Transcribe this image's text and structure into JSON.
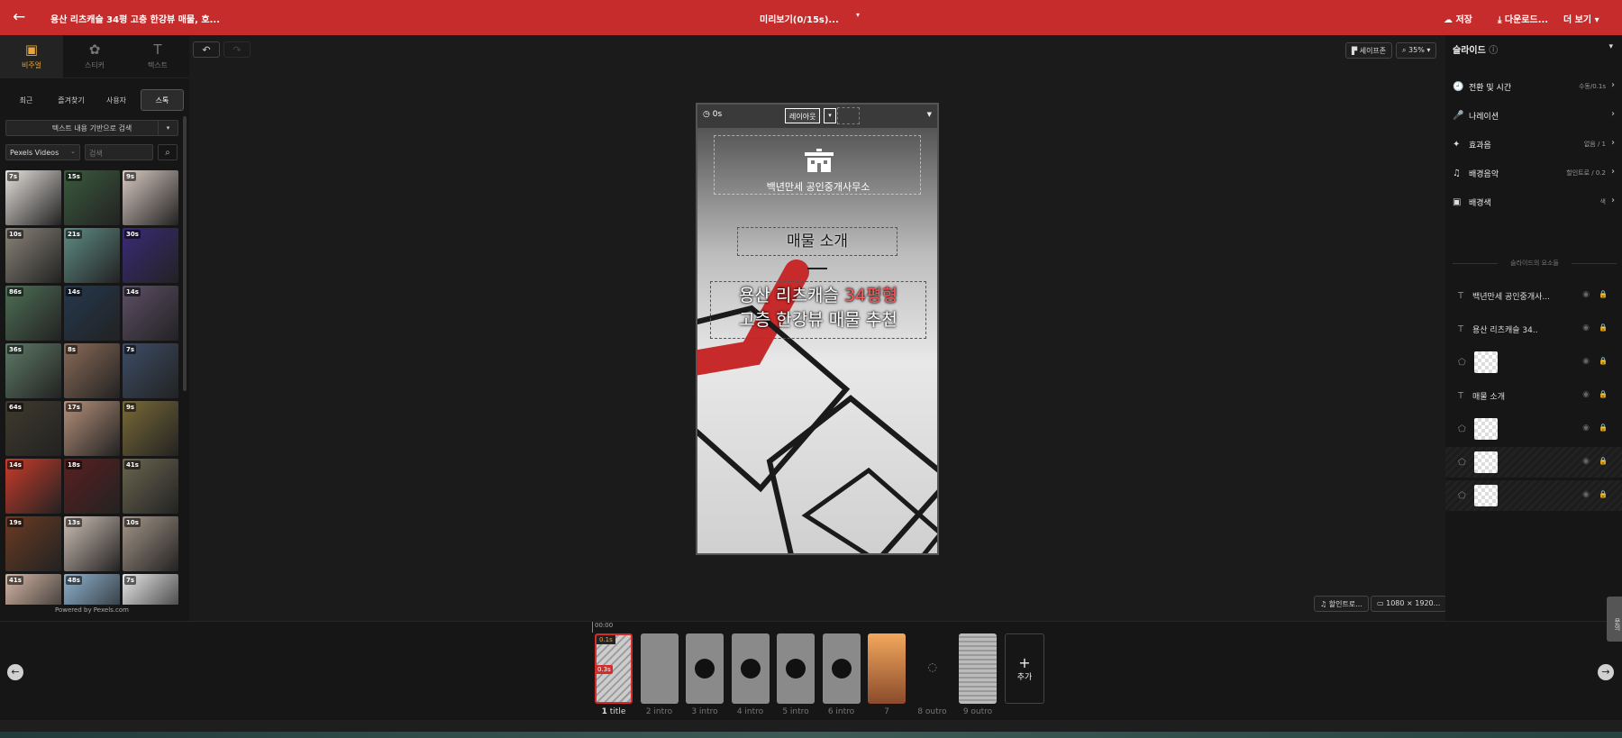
{
  "topbar": {
    "back_label": "←",
    "title": "용산 리츠캐슬 34평 고층 한강뷰 매물, 호...",
    "preview": "미리보기(0/15s)...",
    "preview_caret": "▾",
    "save": "저장",
    "download": "다운로드...",
    "more": "더 보기"
  },
  "left_panel": {
    "tabs": [
      {
        "label": "비주얼",
        "icon": "visual-icon"
      },
      {
        "label": "스티커",
        "icon": "sticker-icon"
      },
      {
        "label": "텍스트",
        "icon": "text-icon"
      }
    ],
    "subtabs": [
      "최근",
      "즐겨찾기",
      "사용자",
      "스톡"
    ],
    "search_mode": "텍스트 내용 기반으로 검색",
    "provider": "Pexels Videos",
    "search_placeholder": "검색",
    "thumbnails": [
      {
        "dur": "7s",
        "color": "#e6e1dc"
      },
      {
        "dur": "15s",
        "color": "#3b5b3d"
      },
      {
        "dur": "9s",
        "color": "#d8c9c2"
      },
      {
        "dur": "10s",
        "color": "#8a8478"
      },
      {
        "dur": "21s",
        "color": "#5f8c84"
      },
      {
        "dur": "30s",
        "color": "#3b2a78"
      },
      {
        "dur": "86s",
        "color": "#4e6f55"
      },
      {
        "dur": "14s",
        "color": "#24384e"
      },
      {
        "dur": "14s",
        "color": "#5d4f66"
      },
      {
        "dur": "36s",
        "color": "#5e7a66"
      },
      {
        "dur": "8s",
        "color": "#8a6b58"
      },
      {
        "dur": "7s",
        "color": "#3d4d66"
      },
      {
        "dur": "64s",
        "color": "#3f3a2d"
      },
      {
        "dur": "17s",
        "color": "#b5907a"
      },
      {
        "dur": "9s",
        "color": "#7a6a37"
      },
      {
        "dur": "14s",
        "color": "#c93b2a"
      },
      {
        "dur": "18s",
        "color": "#5a1f1f"
      },
      {
        "dur": "41s",
        "color": "#6b6650"
      },
      {
        "dur": "19s",
        "color": "#6b3b22"
      },
      {
        "dur": "13s",
        "color": "#cfc0b5"
      },
      {
        "dur": "10s",
        "color": "#a59689"
      },
      {
        "dur": "41s",
        "color": "#d4b7a5"
      },
      {
        "dur": "48s",
        "color": "#8fb2cf"
      },
      {
        "dur": "7s",
        "color": "#e8e8e8"
      }
    ],
    "powered_by": "Powered by Pexels.com"
  },
  "canvas_toolbar": {
    "undo": "↶",
    "redo": "↷",
    "safe_zone": "세이프존",
    "zoom": "35%",
    "music_chip": "할인트로...",
    "size_chip": "1080 × 1920..."
  },
  "phone": {
    "time": "0s",
    "layout_label": "레이아웃",
    "office_name": "백년만세 공인중개사무소",
    "intro_text": "매물 소개",
    "headline_part1": "용산 리츠캐슬 ",
    "headline_red": "34평형",
    "headline_part2": "고층 한강뷰 매물 추천"
  },
  "right_panel": {
    "title": "슬라이드",
    "props": [
      {
        "label": "전환 및 시간",
        "value": "수동/0.1s",
        "icon": "clock-icon",
        "glyph": "🕘"
      },
      {
        "label": "나레이션",
        "value": "",
        "icon": "mic-icon",
        "glyph": "🎤"
      },
      {
        "label": "효과음",
        "value": "없음 / 1",
        "icon": "sparkle-icon",
        "glyph": "✦"
      },
      {
        "label": "배경음악",
        "value": "할인트로 / 0.2",
        "icon": "music-icon",
        "glyph": "♫"
      },
      {
        "label": "배경색",
        "value": "색",
        "icon": "image-icon",
        "glyph": "▣"
      }
    ],
    "elements_label": "슬라이드의 요소들",
    "elements": [
      {
        "type": "text",
        "label": "백년만세 공인중개사...",
        "locked": false
      },
      {
        "type": "text",
        "label": "용산 리츠캐슬 34..",
        "locked": false
      },
      {
        "type": "shape",
        "label": "",
        "locked": false
      },
      {
        "type": "text",
        "label": "매물 소개",
        "locked": false
      },
      {
        "type": "shape",
        "label": "",
        "locked": false
      },
      {
        "type": "shape",
        "label": "",
        "locked": true
      },
      {
        "type": "shape",
        "label": "",
        "locked": true
      }
    ]
  },
  "timeline": {
    "timestamp": "00:00",
    "clips": [
      {
        "num": "1",
        "name": "title",
        "badge": "0.1s",
        "badge2": "0.3s",
        "selected": true
      },
      {
        "num": "2",
        "name": "intro"
      },
      {
        "num": "3",
        "name": "intro"
      },
      {
        "num": "4",
        "name": "intro"
      },
      {
        "num": "5",
        "name": "intro"
      },
      {
        "num": "6",
        "name": "intro"
      },
      {
        "num": "7",
        "name": ""
      },
      {
        "num": "8",
        "name": "outro"
      },
      {
        "num": "9",
        "name": "outro"
      }
    ],
    "add_label": "추가",
    "feedback": "문의"
  }
}
